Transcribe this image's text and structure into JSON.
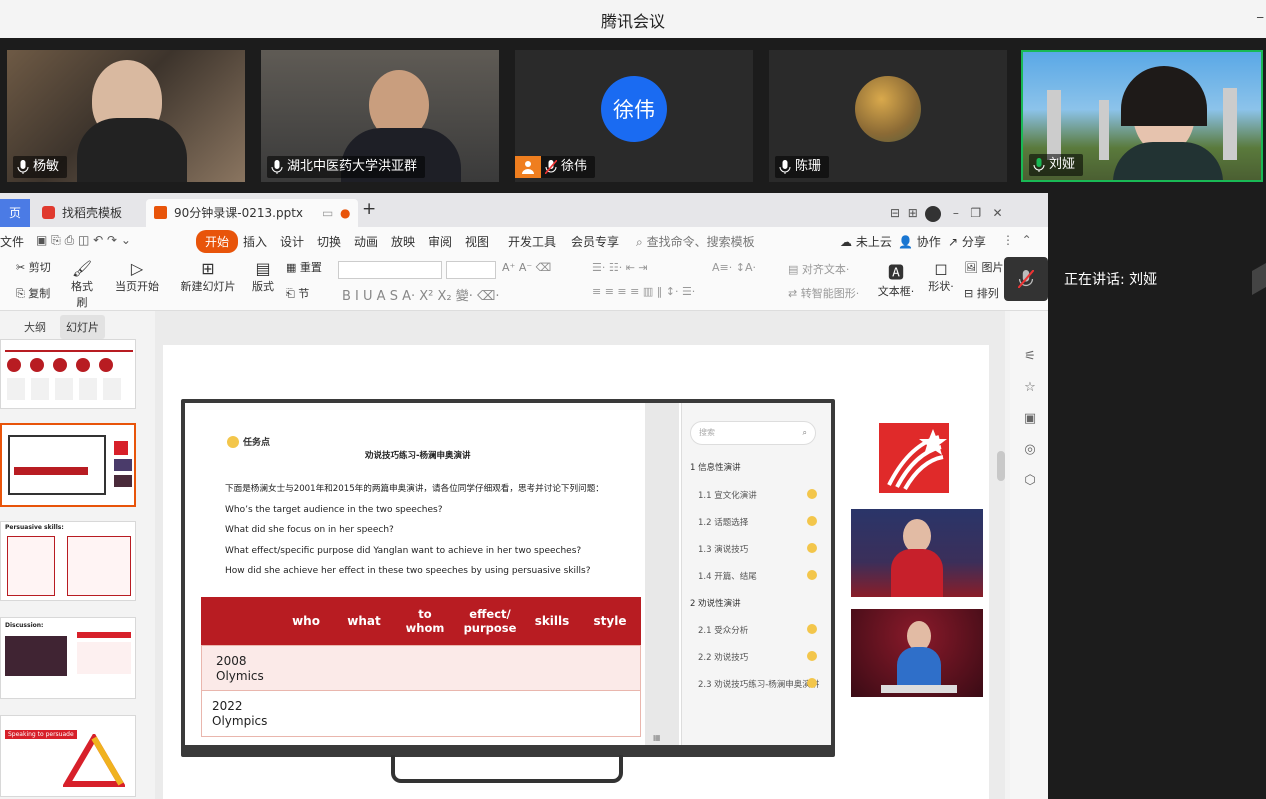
{
  "window": {
    "title": "腾讯会议"
  },
  "participants": [
    {
      "name": "杨敏",
      "mic": "on"
    },
    {
      "name": "湖北中医药大学洪亚群",
      "mic": "on"
    },
    {
      "name": "徐伟",
      "avatar_text": "徐伟",
      "mic": "muted"
    },
    {
      "name": "陈珊",
      "mic": "on"
    },
    {
      "name": "刘娅",
      "mic": "on",
      "active": true
    }
  ],
  "speaking": {
    "label": "正在讲话: 刘娅"
  },
  "wps": {
    "tabs": [
      {
        "label": "页"
      },
      {
        "label": "找稻壳模板"
      },
      {
        "label": "90分钟录课-0213.pptx"
      }
    ],
    "menu": [
      "文件",
      "开始",
      "插入",
      "设计",
      "切换",
      "动画",
      "放映",
      "审阅",
      "视图",
      "开发工具",
      "会员专享"
    ],
    "search_placeholder": "查找命令、搜索模板",
    "cloud": "未上云",
    "collab": "协作",
    "share": "分享",
    "ribbon": {
      "cut": "剪切",
      "copy": "复制",
      "format_painter": "格式刷",
      "play_from_current": "当页开始",
      "new_slide": "新建幻灯片",
      "layout": "版式",
      "reset": "重置",
      "section": "节",
      "align_text": "对齐文本",
      "smart_graphic": "转智能图形",
      "textbox": "文本框",
      "shape": "形状",
      "picture": "图片",
      "arrange": "排列"
    },
    "panel_tabs": [
      "大纲",
      "幻灯片"
    ],
    "thumb_labels": [
      "Persuasive skills:",
      "Discussion:",
      "Speaking to persuade"
    ]
  },
  "slide": {
    "task_label": "任务点",
    "heading": "劝说技巧练习-杨澜申奥演讲",
    "intro": "下面是杨澜女士与2001年和2015年的两篇申奥演讲，请各位同学仔细观看，思考并讨论下列问题：",
    "questions": [
      "Who’s the target audience in the two speeches?",
      "What did she focus on in her speech?",
      "What effect/specific purpose did Yanglan want to achieve in her two speeches?",
      "How did she achieve her effect in these two speeches by using  persuasive skills?"
    ],
    "table": {
      "headers": [
        "",
        "who",
        "what",
        "to\nwhom",
        "effect/\npurpose",
        "skills",
        "style"
      ],
      "rows": [
        [
          "2008\nOlymics"
        ],
        [
          "2022\nOlympics"
        ]
      ]
    },
    "playlist": {
      "search_placeholder": "搜索",
      "sections": [
        {
          "title": "1 信息性演讲",
          "items": [
            "1.1 宣文化演讲",
            "1.2 话题选择",
            "1.3 演说技巧",
            "1.4 开篇、结尾"
          ]
        },
        {
          "title": "2 劝说性演讲",
          "items": [
            "2.1 受众分析",
            "2.2 劝说技巧",
            "2.3 劝说技巧练习-杨澜申奥演讲"
          ]
        }
      ]
    }
  },
  "colors": {
    "accent": "#b81c22",
    "wps_orange": "#e8540a",
    "meeting_active": "#19b955"
  }
}
